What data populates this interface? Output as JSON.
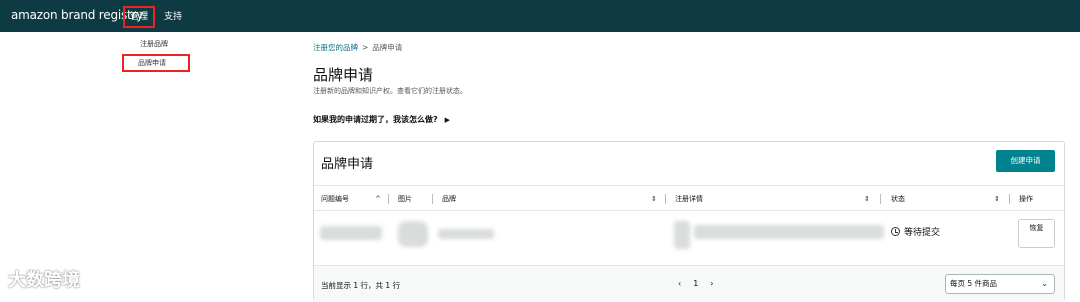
{
  "header": {
    "logo_text": "amazon brand registry",
    "nav": [
      "管理",
      "支持"
    ]
  },
  "dropdown": {
    "items": [
      "注册品牌",
      "品牌申请"
    ]
  },
  "breadcrumb": {
    "parent": "注册您的品牌",
    "separator": ">",
    "current": "品牌申请"
  },
  "page": {
    "title": "品牌申请",
    "subtitle": "注册新的品牌和知识产权。查看它们的注册状态。",
    "faq": "如果我的申请过期了，我该怎么做?"
  },
  "card": {
    "title": "品牌申请",
    "create_button": "创建申请",
    "columns": [
      "问题编号",
      "图片",
      "品牌",
      "注册详情",
      "状态",
      "操作"
    ],
    "rows": [
      {
        "status": "等待提交",
        "action": "恢复"
      }
    ],
    "footer": {
      "showing": "当前显示 1 行，共 1 行",
      "page": "1",
      "per_page": "每页 5 件商品"
    }
  },
  "watermark": "大数跨境"
}
